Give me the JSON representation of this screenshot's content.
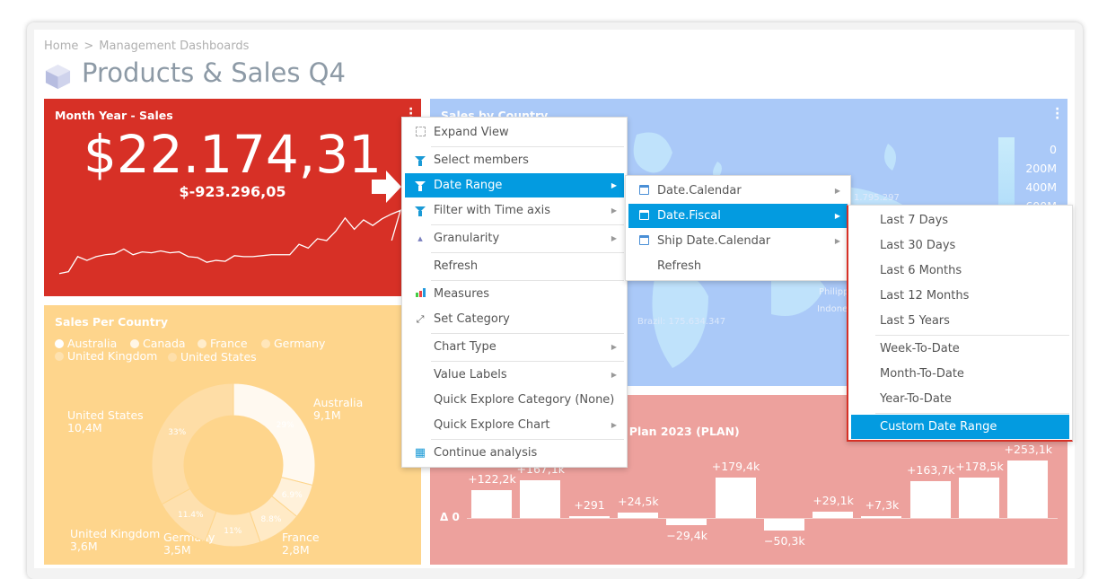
{
  "breadcrumb": [
    "Home",
    ">",
    "Management Dashboards"
  ],
  "page_title": "Products & Sales Q4",
  "kpi_tile": {
    "title": "Month Year - Sales",
    "value": "$22.174,31",
    "delta": "$-923.296,05",
    "color": "#d73026",
    "sparkline": [
      5,
      7,
      23,
      19,
      23,
      25,
      26,
      31,
      25,
      28,
      27,
      29,
      27,
      28,
      23,
      22,
      17,
      19,
      18,
      24,
      23,
      23,
      24,
      25,
      25,
      25,
      36,
      32,
      42,
      40,
      50,
      64,
      52,
      62,
      56,
      63,
      68,
      72,
      40
    ]
  },
  "donut_tile": {
    "title": "Sales Per Country",
    "color": "#fed58c",
    "legend": [
      "Australia",
      "Canada",
      "France",
      "Germany",
      "United Kingdom",
      "United States"
    ]
  },
  "map_tile": {
    "title": "Sales by Country",
    "legend": [
      "0",
      "200M",
      "400M",
      "600M"
    ],
    "labels": {
      "brazil": "Brazil: 175.634.347",
      "philippines": "Philipp",
      "indonesia": "Indone",
      "partial": "1.795.297"
    }
  },
  "bar_tile": {
    "title": "s Plan 2023 (PLAN)",
    "zero_label": "Δ 0"
  },
  "chart_data": [
    {
      "type": "pie",
      "title": "Sales Per Country",
      "categories": [
        "Australia",
        "Canada",
        "France",
        "Germany",
        "United Kingdom",
        "United States"
      ],
      "percent": [
        29,
        6.9,
        8.8,
        11,
        11.4,
        33
      ],
      "labels": [
        "9,1M",
        "",
        "2,8M",
        "3,5M",
        "3,6M",
        "10,4M"
      ],
      "percent_labels": [
        "29%",
        "6.9%",
        "8.8%",
        "11%",
        "11.4%",
        "33%"
      ],
      "colors": [
        "#fff9f0",
        "#fff1da",
        "#ffeac6",
        "#ffe5b8",
        "#fee0ae",
        "#fedda6"
      ],
      "legend": "top-left"
    },
    {
      "type": "bar",
      "values": [
        122.2,
        167.1,
        0.291,
        24.5,
        -29.4,
        179.4,
        -50.3,
        29.1,
        7.3,
        163.7,
        178.5,
        253.1
      ],
      "labels": [
        "+122,2k",
        "+167,1k",
        "+291",
        "+24,5k",
        "−29,4k",
        "+179,4k",
        "−50,3k",
        "+29,1k",
        "+7,3k",
        "+163,7k",
        "+178,5k",
        "+253,1k"
      ],
      "unit": "k"
    }
  ],
  "menu": {
    "items": [
      {
        "label": "Expand View",
        "icon": "expand-icon"
      },
      {
        "label": "Select members",
        "icon": "filter-icon"
      },
      {
        "label": "Date Range",
        "icon": "filter-icon",
        "submenu": true,
        "active": true
      },
      {
        "label": "Filter with Time axis",
        "icon": "filter-icon",
        "submenu": true
      },
      {
        "label": "Granularity",
        "icon": "granularity-icon",
        "submenu": true
      },
      {
        "label": "Refresh"
      },
      {
        "label": "Measures",
        "icon": "bar-chart-icon"
      },
      {
        "label": "Set Category",
        "icon": "axis-icon"
      },
      {
        "label": "Chart Type",
        "submenu": true
      },
      {
        "label": "Value Labels",
        "submenu": true
      },
      {
        "label": "Quick Explore Category (None)"
      },
      {
        "label": "Quick Explore Chart",
        "submenu": true
      },
      {
        "label": "Continue analysis",
        "icon": "grid-icon"
      }
    ]
  },
  "submenu": {
    "items": [
      {
        "label": "Date.Calendar",
        "icon": "calendar-icon"
      },
      {
        "label": "Date.Fiscal",
        "icon": "calendar-icon",
        "active": true
      },
      {
        "label": "Ship Date.Calendar",
        "icon": "calendar-icon"
      },
      {
        "label": "Refresh"
      }
    ]
  },
  "submenu2": {
    "items": [
      "Last 7 Days",
      "Last 30 Days",
      "Last 6 Months",
      "Last 12 Months",
      "Last 5 Years",
      "Week-To-Date",
      "Month-To-Date",
      "Year-To-Date",
      "Custom Date Range"
    ],
    "active": "Custom Date Range"
  },
  "colors": {
    "accent": "#039be0"
  }
}
